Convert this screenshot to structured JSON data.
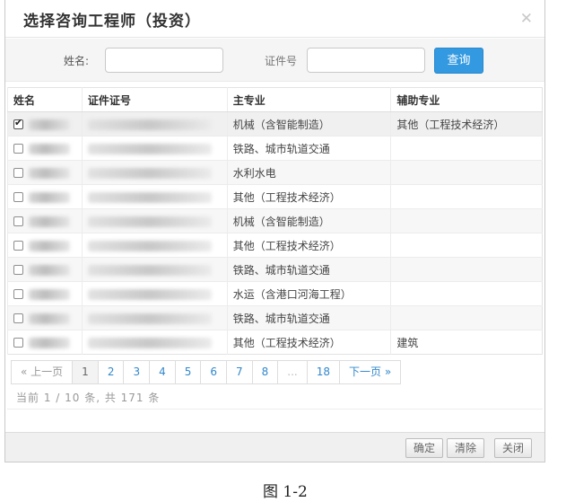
{
  "dialog": {
    "title": "选择咨询工程师（投资）",
    "close_icon": "close-icon"
  },
  "search": {
    "name_label": "姓名:",
    "name_value": "",
    "cert_label": "证件号",
    "cert_value": "",
    "button": "查询"
  },
  "table": {
    "headers": [
      "姓名",
      "证件证号",
      "主专业",
      "辅助专业"
    ],
    "rows": [
      {
        "checked": true,
        "major": "机械（含智能制造）",
        "aux": "其他（工程技术经济）"
      },
      {
        "checked": false,
        "major": "铁路、城市轨道交通",
        "aux": ""
      },
      {
        "checked": false,
        "major": "水利水电",
        "aux": ""
      },
      {
        "checked": false,
        "major": "其他（工程技术经济）",
        "aux": ""
      },
      {
        "checked": false,
        "major": "机械（含智能制造）",
        "aux": ""
      },
      {
        "checked": false,
        "major": "其他（工程技术经济）",
        "aux": ""
      },
      {
        "checked": false,
        "major": "铁路、城市轨道交通",
        "aux": ""
      },
      {
        "checked": false,
        "major": "水运（含港口河海工程）",
        "aux": ""
      },
      {
        "checked": false,
        "major": "铁路、城市轨道交通",
        "aux": ""
      },
      {
        "checked": false,
        "major": "其他（工程技术经济）",
        "aux": "建筑"
      }
    ]
  },
  "pager": {
    "prev": "« 上一页",
    "pages": [
      "1",
      "2",
      "3",
      "4",
      "5",
      "6",
      "7",
      "8",
      "...",
      "18"
    ],
    "current": "1",
    "next": "下一页 »",
    "info": "当前 1 / 10 条, 共 171 条"
  },
  "footer": {
    "ok": "确定",
    "clear": "清除",
    "close": "关闭"
  },
  "caption": "图 1-2"
}
